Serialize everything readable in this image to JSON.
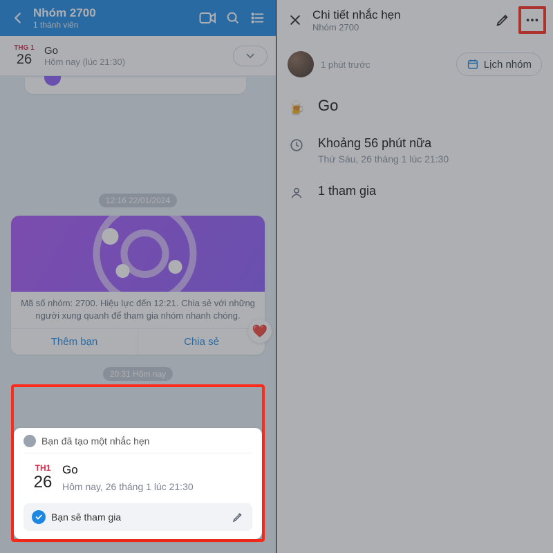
{
  "left": {
    "header": {
      "title": "Nhóm 2700",
      "subtitle": "1 thành viên"
    },
    "pinned": {
      "month": "THG 1",
      "day": "26",
      "title": "Go",
      "subtitle": "Hôm nay (lúc 21:30)"
    },
    "ts1": "12:16 22/01/2024",
    "share": {
      "text": "Mã số nhóm: 2700. Hiệu lực đến 12:21. Chia sẻ với những người xung quanh để tham gia nhóm nhanh chóng.",
      "add": "Thêm bạn",
      "shareLbl": "Chia sẻ"
    },
    "ts2": "20:31 Hôm nay",
    "reminder": {
      "head": "Bạn đã tạo một nhắc hẹn",
      "month": "TH1",
      "day": "26",
      "title": "Go",
      "subtitle": "Hôm nay, 26 tháng 1 lúc 21:30",
      "footer": "Bạn sẽ tham gia"
    }
  },
  "right": {
    "header": {
      "title": "Chi tiết nhắc hẹn",
      "subtitle": "Nhóm 2700"
    },
    "meta": {
      "time": "1 phút trước",
      "calendar": "Lịch nhóm"
    },
    "event": {
      "title": "Go",
      "remaining": "Khoảng 56 phút nữa",
      "datetime": "Thứ Sáu, 26 tháng 1 lúc 21:30",
      "participants": "1 tham gia"
    }
  }
}
